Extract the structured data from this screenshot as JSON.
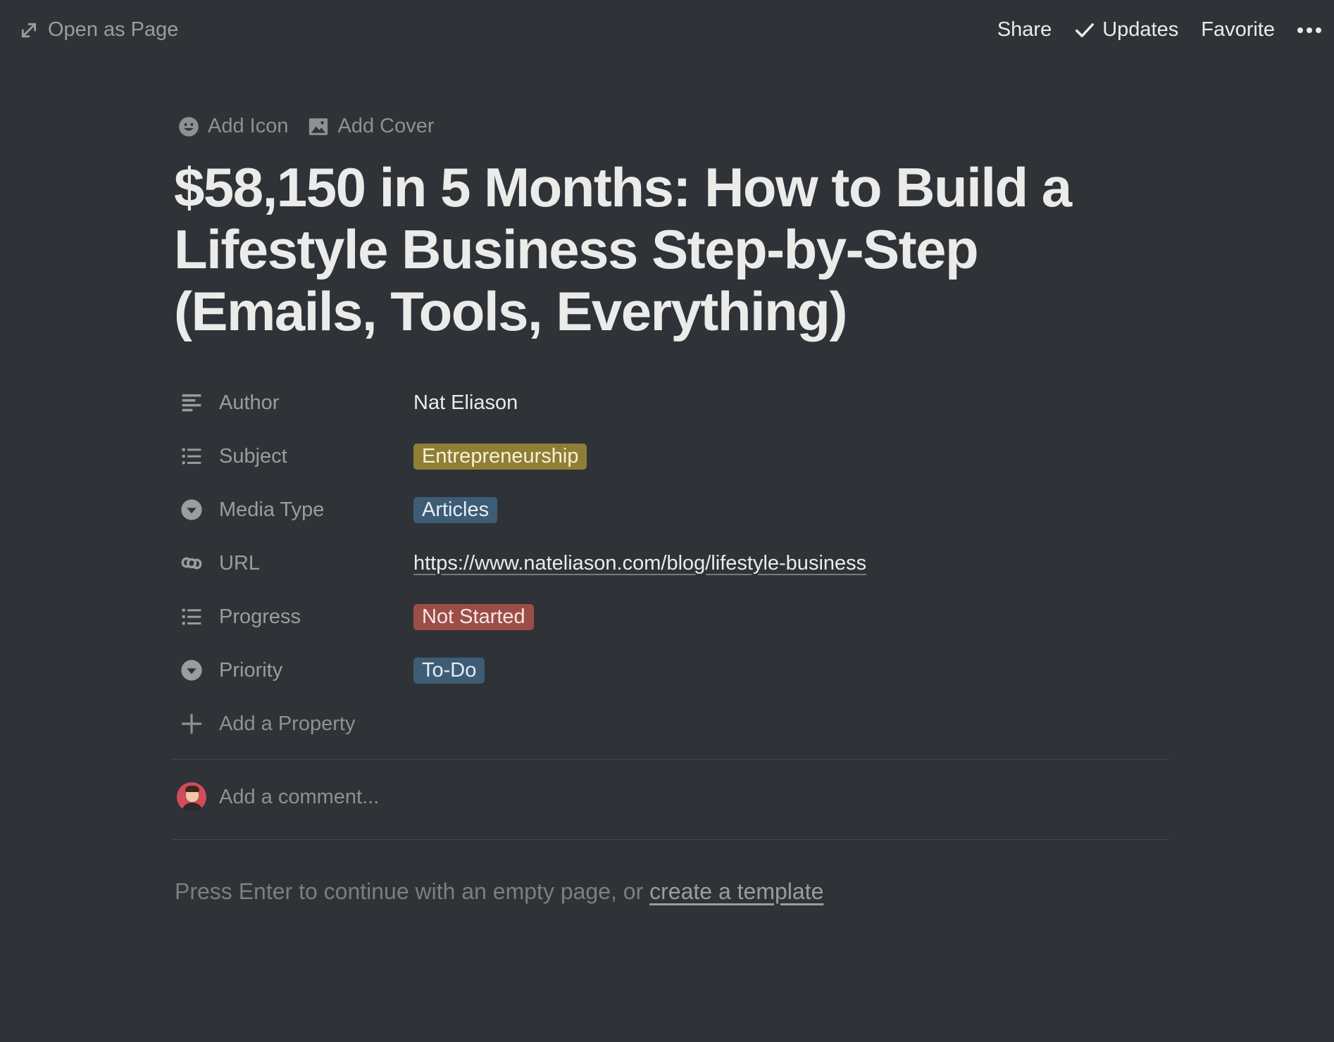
{
  "topbar": {
    "open_as_page": "Open as Page",
    "share": "Share",
    "updates": "Updates",
    "favorite": "Favorite"
  },
  "page_controls": {
    "add_icon": "Add Icon",
    "add_cover": "Add Cover"
  },
  "page": {
    "title": "$58,150 in 5 Months: How to Build a Lifestyle Business Step-by-Step (Emails, Tools, Everything)"
  },
  "properties": [
    {
      "name": "Author",
      "icon": "text-icon",
      "value": "Nat Eliason"
    },
    {
      "name": "Subject",
      "icon": "list-icon",
      "value": "Entrepreneurship",
      "color": "#8f7f35"
    },
    {
      "name": "Media Type",
      "icon": "select-icon",
      "value": "Articles",
      "color": "#3d5c76"
    },
    {
      "name": "URL",
      "icon": "link-icon",
      "value": "https://www.nateliason.com/blog/lifestyle-business"
    },
    {
      "name": "Progress",
      "icon": "list-icon",
      "value": "Not Started",
      "color": "#9c4d48"
    },
    {
      "name": "Priority",
      "icon": "select-icon",
      "value": "To-Do",
      "color": "#3d5c76"
    }
  ],
  "add_property": "Add a Property",
  "comment": {
    "placeholder": "Add a comment..."
  },
  "empty_hint": {
    "text": "Press Enter to continue with an empty page, or ",
    "link": "create a template"
  }
}
